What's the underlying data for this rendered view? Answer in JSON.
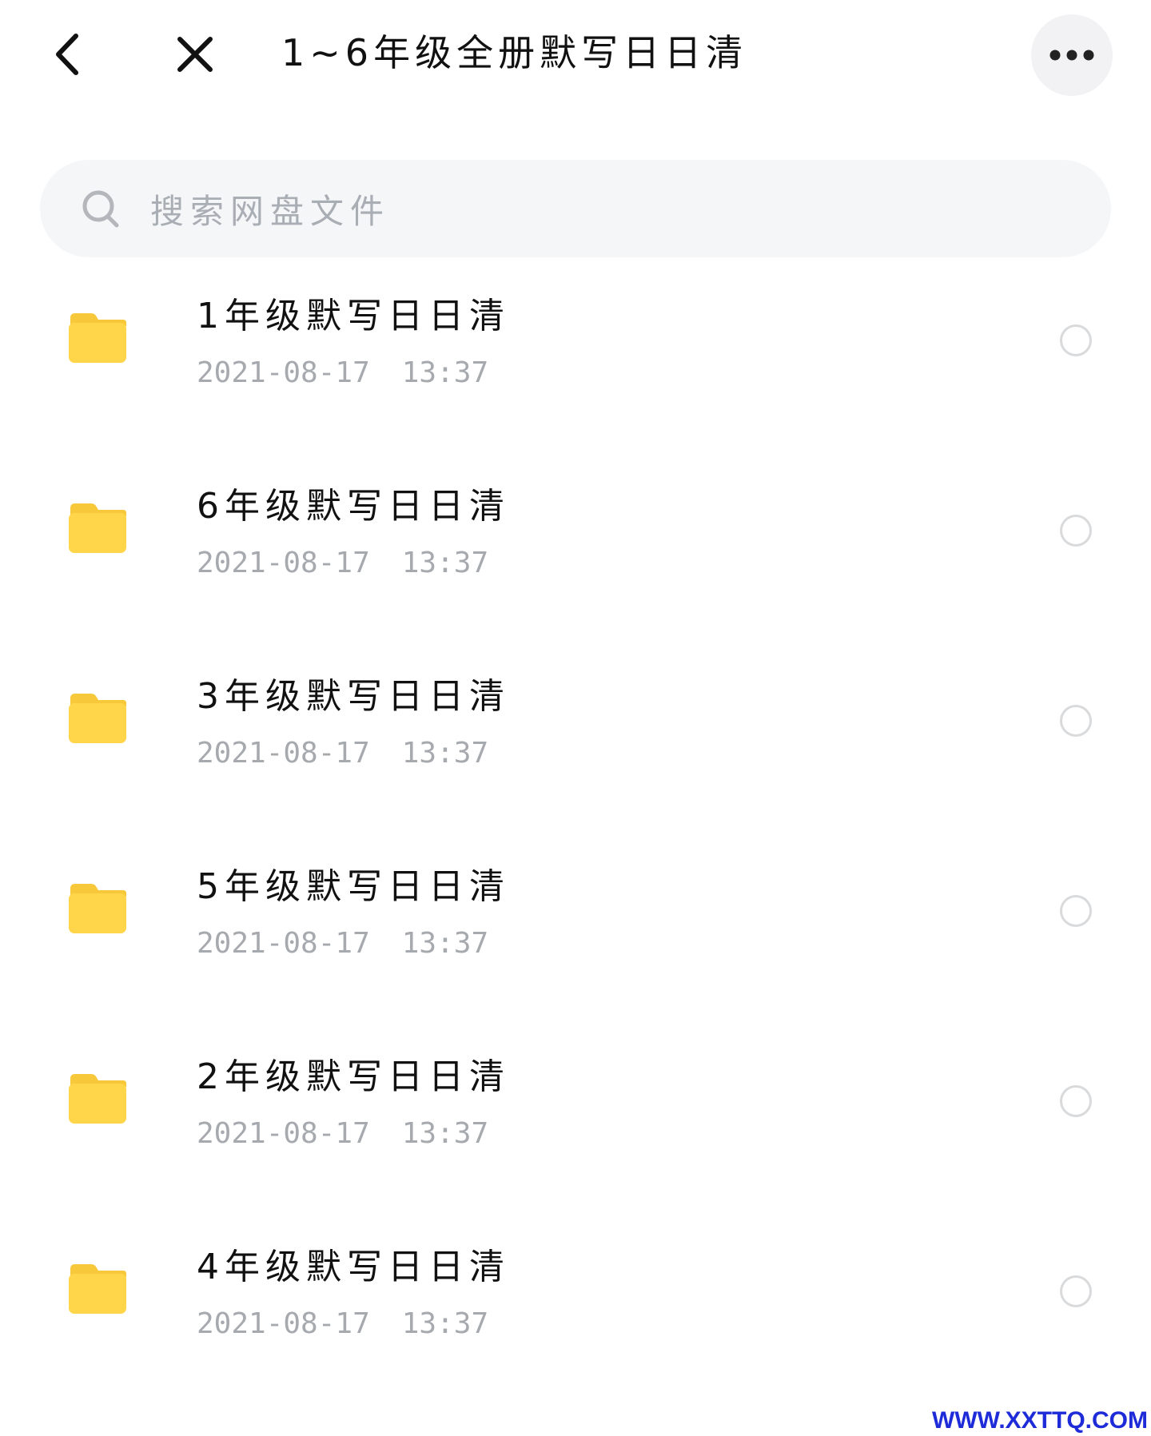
{
  "header": {
    "title": "1~6年级全册默写日日清",
    "back_icon": "chevron-left-icon",
    "close_icon": "close-icon",
    "more_icon": "more-horizontal-icon"
  },
  "search": {
    "placeholder": "搜索网盘文件",
    "icon": "search-icon"
  },
  "files": [
    {
      "name": "1年级默写日日清",
      "date": "2021-08-17",
      "time": "13:37",
      "type": "folder"
    },
    {
      "name": "6年级默写日日清",
      "date": "2021-08-17",
      "time": "13:37",
      "type": "folder"
    },
    {
      "name": "3年级默写日日清",
      "date": "2021-08-17",
      "time": "13:37",
      "type": "folder"
    },
    {
      "name": "5年级默写日日清",
      "date": "2021-08-17",
      "time": "13:37",
      "type": "folder"
    },
    {
      "name": "2年级默写日日清",
      "date": "2021-08-17",
      "time": "13:37",
      "type": "folder"
    },
    {
      "name": "4年级默写日日清",
      "date": "2021-08-17",
      "time": "13:37",
      "type": "folder"
    }
  ],
  "watermark": "WWW.XXTTQ.COM",
  "colors": {
    "folder": "#ffd54a",
    "folder_tab": "#f7c83a",
    "meta_text": "#a6a9ae",
    "placeholder": "#a9adb4",
    "watermark": "#1d2bd8"
  }
}
